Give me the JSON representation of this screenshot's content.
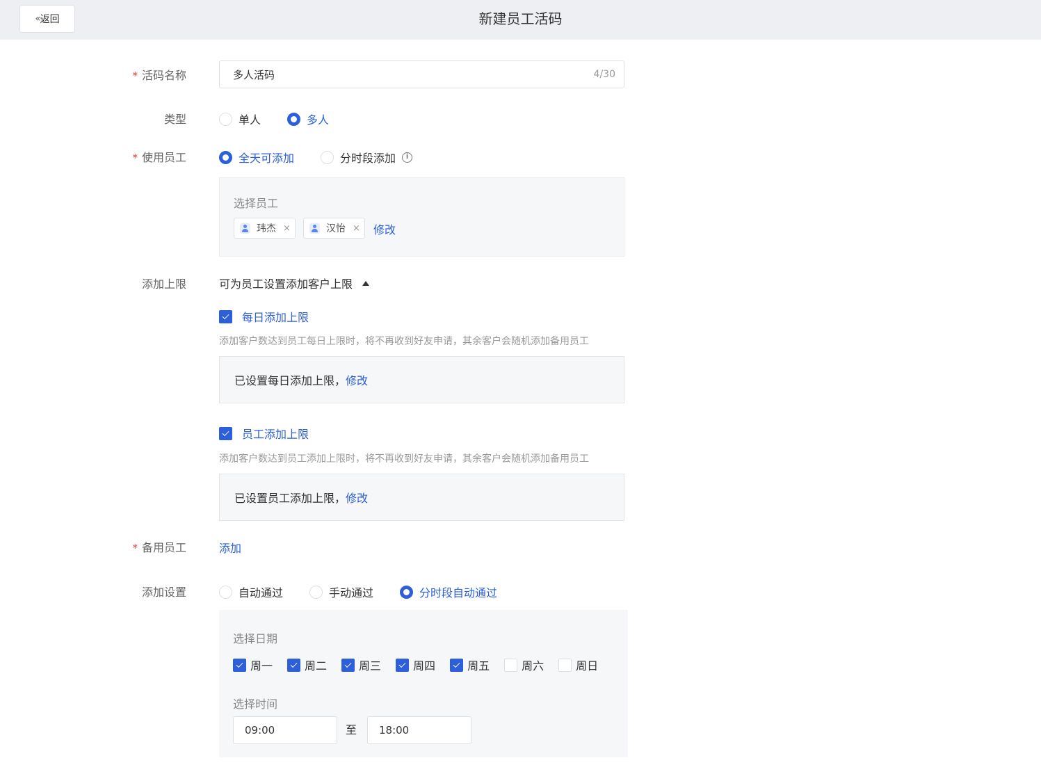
{
  "header": {
    "back_label": "返回",
    "title": "新建员工活码"
  },
  "form": {
    "name": {
      "label": "活码名称",
      "value": "多人活码",
      "counter": "4/30"
    },
    "type": {
      "label": "类型",
      "options": [
        "单人",
        "多人"
      ],
      "selected": "多人"
    },
    "staff": {
      "label": "使用员工",
      "options": [
        "全天可添加",
        "分时段添加"
      ],
      "selected": "全天可添加",
      "panel_title": "选择员工",
      "tags": [
        "玮杰",
        "汉怡"
      ],
      "modify_label": "修改"
    },
    "limit": {
      "label": "添加上限",
      "toggle_text": "可为员工设置添加客户上限",
      "daily": {
        "label": "每日添加上限",
        "checked": true,
        "hint": "添加客户数达到员工每日上限时，将不再收到好友申请，其余客户会随机添加备用员工",
        "status": "已设置每日添加上限，",
        "modify_label": "修改"
      },
      "staff_limit": {
        "label": "员工添加上限",
        "checked": true,
        "hint": "添加客户数达到员工添加上限时，将不再收到好友申请，其余客户会随机添加备用员工",
        "status": "已设置员工添加上限，",
        "modify_label": "修改"
      }
    },
    "backup": {
      "label": "备用员工",
      "add_label": "添加"
    },
    "add_setting": {
      "label": "添加设置",
      "options": [
        "自动通过",
        "手动通过",
        "分时段自动通过"
      ],
      "selected": "分时段自动通过",
      "date_title": "选择日期",
      "days": [
        {
          "label": "周一",
          "checked": true
        },
        {
          "label": "周二",
          "checked": true
        },
        {
          "label": "周三",
          "checked": true
        },
        {
          "label": "周四",
          "checked": true
        },
        {
          "label": "周五",
          "checked": true
        },
        {
          "label": "周六",
          "checked": false
        },
        {
          "label": "周日",
          "checked": false
        }
      ],
      "time_title": "选择时间",
      "time_start": "09:00",
      "time_sep": "至",
      "time_end": "18:00"
    }
  },
  "colors": {
    "accent": "#2c5fd9",
    "required": "#e0413d",
    "header_bg": "#eeeff2",
    "panel_bg": "#f6f7f9"
  },
  "icons": [
    "double-chevron-left-icon",
    "info-icon",
    "avatar-icon",
    "close-icon",
    "caret-up-icon",
    "check-icon"
  ]
}
